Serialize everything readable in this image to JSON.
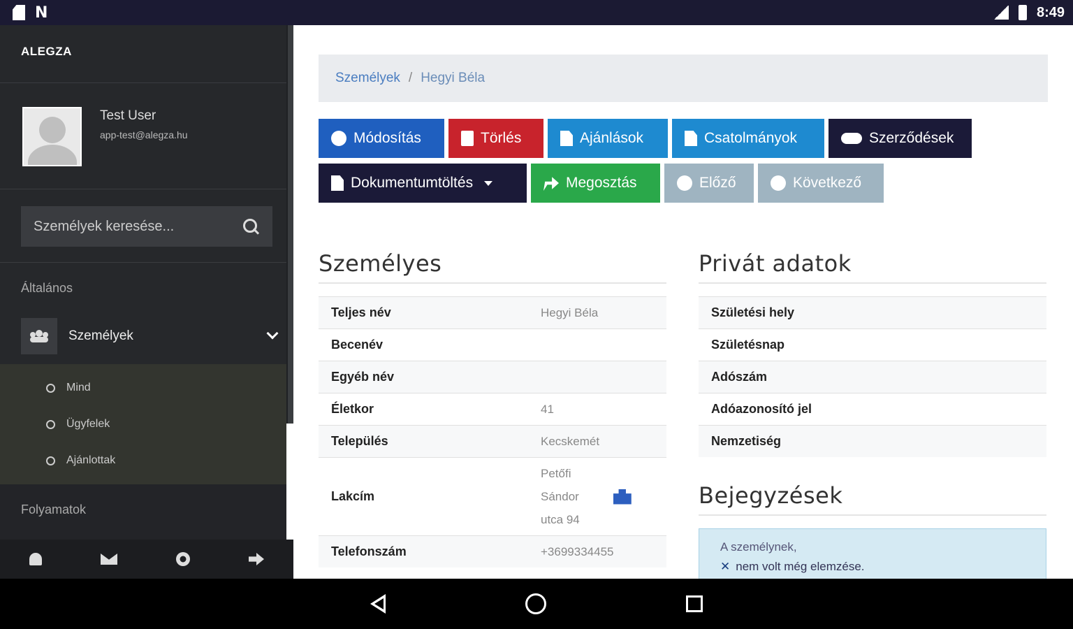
{
  "status_bar": {
    "time": "8:49"
  },
  "sidebar": {
    "brand": "ALEGZA",
    "user": {
      "name": "Test User",
      "email": "app-test@alegza.hu"
    },
    "search": {
      "placeholder": "Személyek keresése..."
    },
    "section_general": "Általános",
    "nav_people": "Személyek",
    "subnav": [
      "Mind",
      "Ügyfelek",
      "Ajánlottak"
    ],
    "section_processes": "Folyamatok"
  },
  "breadcrumb": {
    "root": "Személyek",
    "separator": "/",
    "current": "Hegyi Béla"
  },
  "buttons": {
    "edit": "Módosítás",
    "delete": "Törlés",
    "offers": "Ajánlások",
    "attachments": "Csatolmányok",
    "contracts": "Szerződések",
    "download": "Dokumentumtöltés",
    "share": "Megosztás",
    "prev": "Előző",
    "next": "Következő"
  },
  "personal": {
    "title": "Személyes",
    "rows": [
      {
        "key": "Teljes név",
        "value": "Hegyi Béla"
      },
      {
        "key": "Becenév",
        "value": ""
      },
      {
        "key": "Egyéb név",
        "value": ""
      },
      {
        "key": "Életkor",
        "value": "41"
      },
      {
        "key": "Település",
        "value": "Kecskemét"
      },
      {
        "key": "Lakcím",
        "value_lines": [
          "Petőfi",
          "Sándor",
          "utca 94"
        ]
      },
      {
        "key": "Telefonszám",
        "value": "+3699334455"
      }
    ]
  },
  "private": {
    "title": "Privát adatok",
    "rows": [
      {
        "key": "Születési hely"
      },
      {
        "key": "Születésnap"
      },
      {
        "key": "Adószám"
      },
      {
        "key": "Adóazonosító jel"
      },
      {
        "key": "Nemzetiség"
      }
    ]
  },
  "entries": {
    "title": "Bejegyzések",
    "notice_line1": "A személynek,",
    "notice_line2": "nem volt még elemzése."
  },
  "colors": {
    "edit": "#1f5fbf",
    "delete": "#c8232c",
    "info": "#1e8ad0",
    "dark": "#1b1a38",
    "success": "#2aa84a",
    "disabled": "#9fb4c1"
  }
}
